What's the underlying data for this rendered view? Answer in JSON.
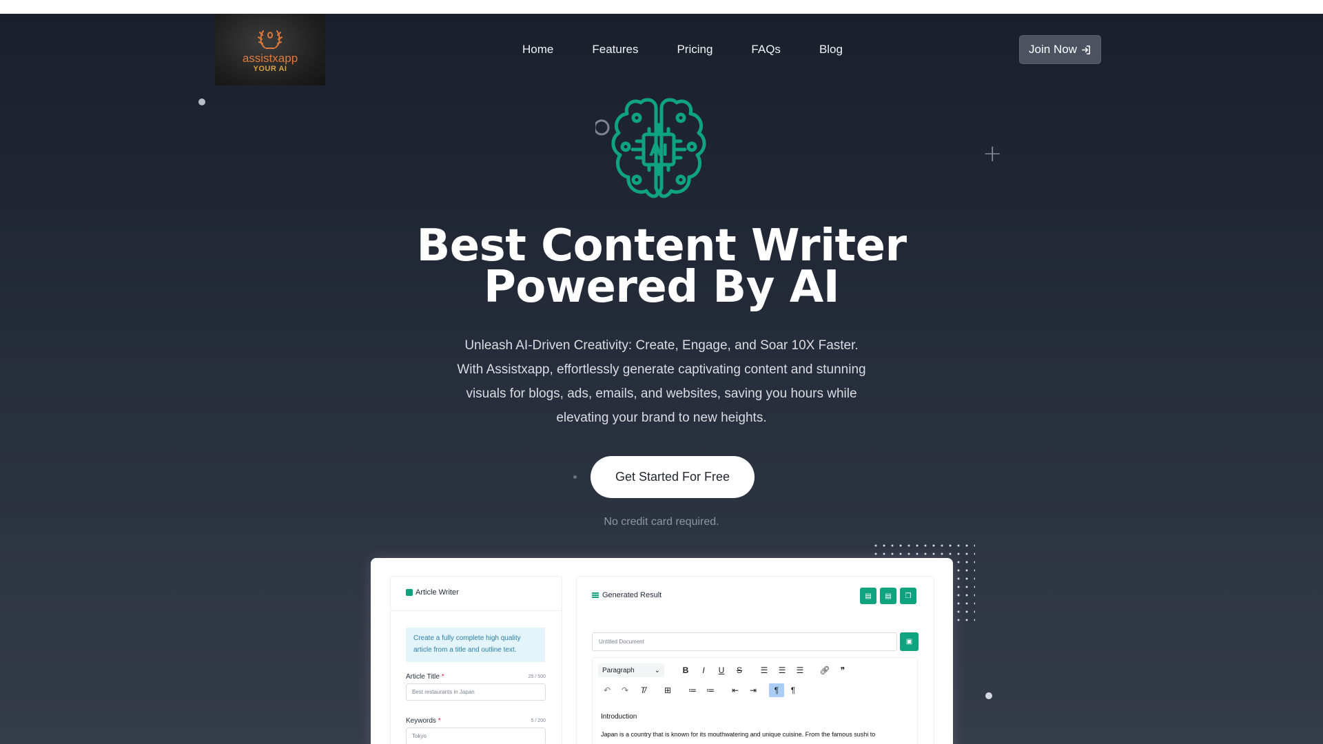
{
  "brand": {
    "name": "assistxapp",
    "tagline": "YOUR AI"
  },
  "nav": {
    "items": [
      {
        "label": "Home"
      },
      {
        "label": "Features"
      },
      {
        "label": "Pricing"
      },
      {
        "label": "FAQs"
      },
      {
        "label": "Blog"
      }
    ],
    "join_label": "Join Now"
  },
  "hero": {
    "icon_label": "AI",
    "title_line1": "Best Content Writer",
    "title_line2": "Powered By AI",
    "subtitle": "Unleash AI-Driven Creativity: Create, Engage, and Soar 10X Faster. With Assistxapp, effortlessly generate captivating content and stunning visuals for blogs, ads, emails, and websites, saving you hours while elevating your brand to new heights.",
    "cta_label": "Get Started For Free",
    "note": "No credit card required."
  },
  "preview": {
    "left": {
      "title": "Article Writer",
      "info": "Create a fully complete high quality article from a title and outline text.",
      "fields": [
        {
          "label": "Article Title",
          "required": "*",
          "count": "25 / 500",
          "value": "Best restaurants in Japan"
        },
        {
          "label": "Keywords",
          "required": "*",
          "count": "5 / 200",
          "value": "Tokyo"
        }
      ]
    },
    "right": {
      "title": "Generated Result",
      "doc_placeholder": "Untitled Document",
      "paragraph_select": "Paragraph",
      "content_heading": "Introduction",
      "content_text": "Japan is a country that is known for its mouthwatering and unique cuisine. From the famous sushi to"
    }
  },
  "colors": {
    "accent": "#10a37f",
    "hero_bg_top": "#1a1f2b",
    "hero_bg_bottom": "#353c49",
    "logo_text": "#e2793a"
  },
  "icons": {
    "join": "sign-in-icon",
    "hero": "ai-brain-chip-icon",
    "decor": "plus-icon"
  }
}
